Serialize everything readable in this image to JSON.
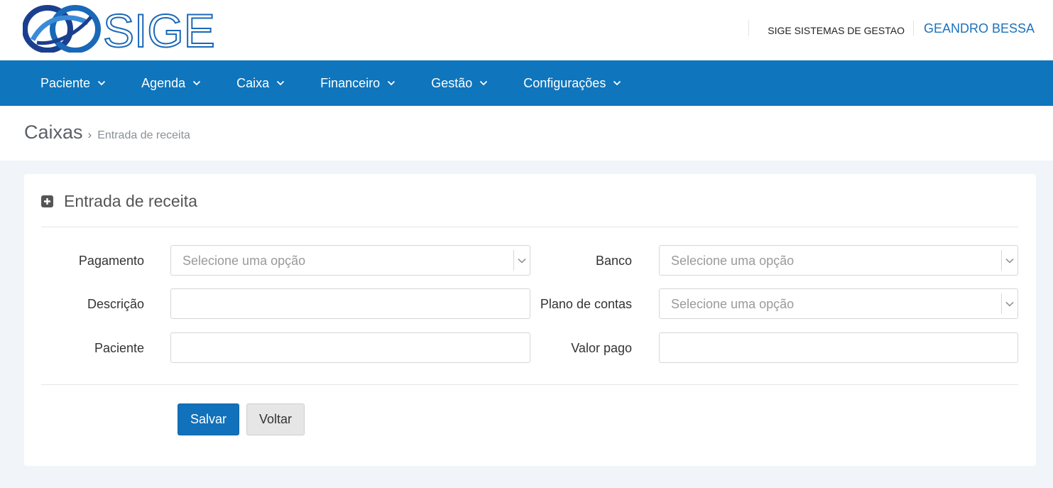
{
  "header": {
    "logo_text": "SIGE",
    "company": "SIGE SISTEMAS DE GESTAO",
    "username": "GEANDRO BESSA"
  },
  "nav": {
    "items": [
      {
        "label": "Paciente"
      },
      {
        "label": "Agenda"
      },
      {
        "label": "Caixa"
      },
      {
        "label": "Financeiro"
      },
      {
        "label": "Gestão"
      },
      {
        "label": "Configurações"
      }
    ]
  },
  "breadcrumb": {
    "main": "Caixas",
    "separator": "›",
    "sub": "Entrada de receita"
  },
  "form": {
    "title": "Entrada de receita",
    "pagamento": {
      "label": "Pagamento",
      "placeholder": "Selecione uma opção"
    },
    "banco": {
      "label": "Banco",
      "placeholder": "Selecione uma opção"
    },
    "descricao": {
      "label": "Descrição",
      "value": ""
    },
    "plano": {
      "label": "Plano de contas",
      "placeholder": "Selecione uma opção"
    },
    "paciente": {
      "label": "Paciente",
      "value": ""
    },
    "valor": {
      "label": "Valor pago",
      "value": ""
    },
    "save_label": "Salvar",
    "back_label": "Voltar"
  },
  "colors": {
    "brand_blue": "#0f75bc",
    "primary_button": "#1271bb",
    "background": "#f1f4f8"
  },
  "icons": {
    "logo": "sige-infinity-logo",
    "nav_dropdown": "chevron-down-icon",
    "panel": "plus-square-icon",
    "select_arrow": "chevron-down-icon"
  }
}
